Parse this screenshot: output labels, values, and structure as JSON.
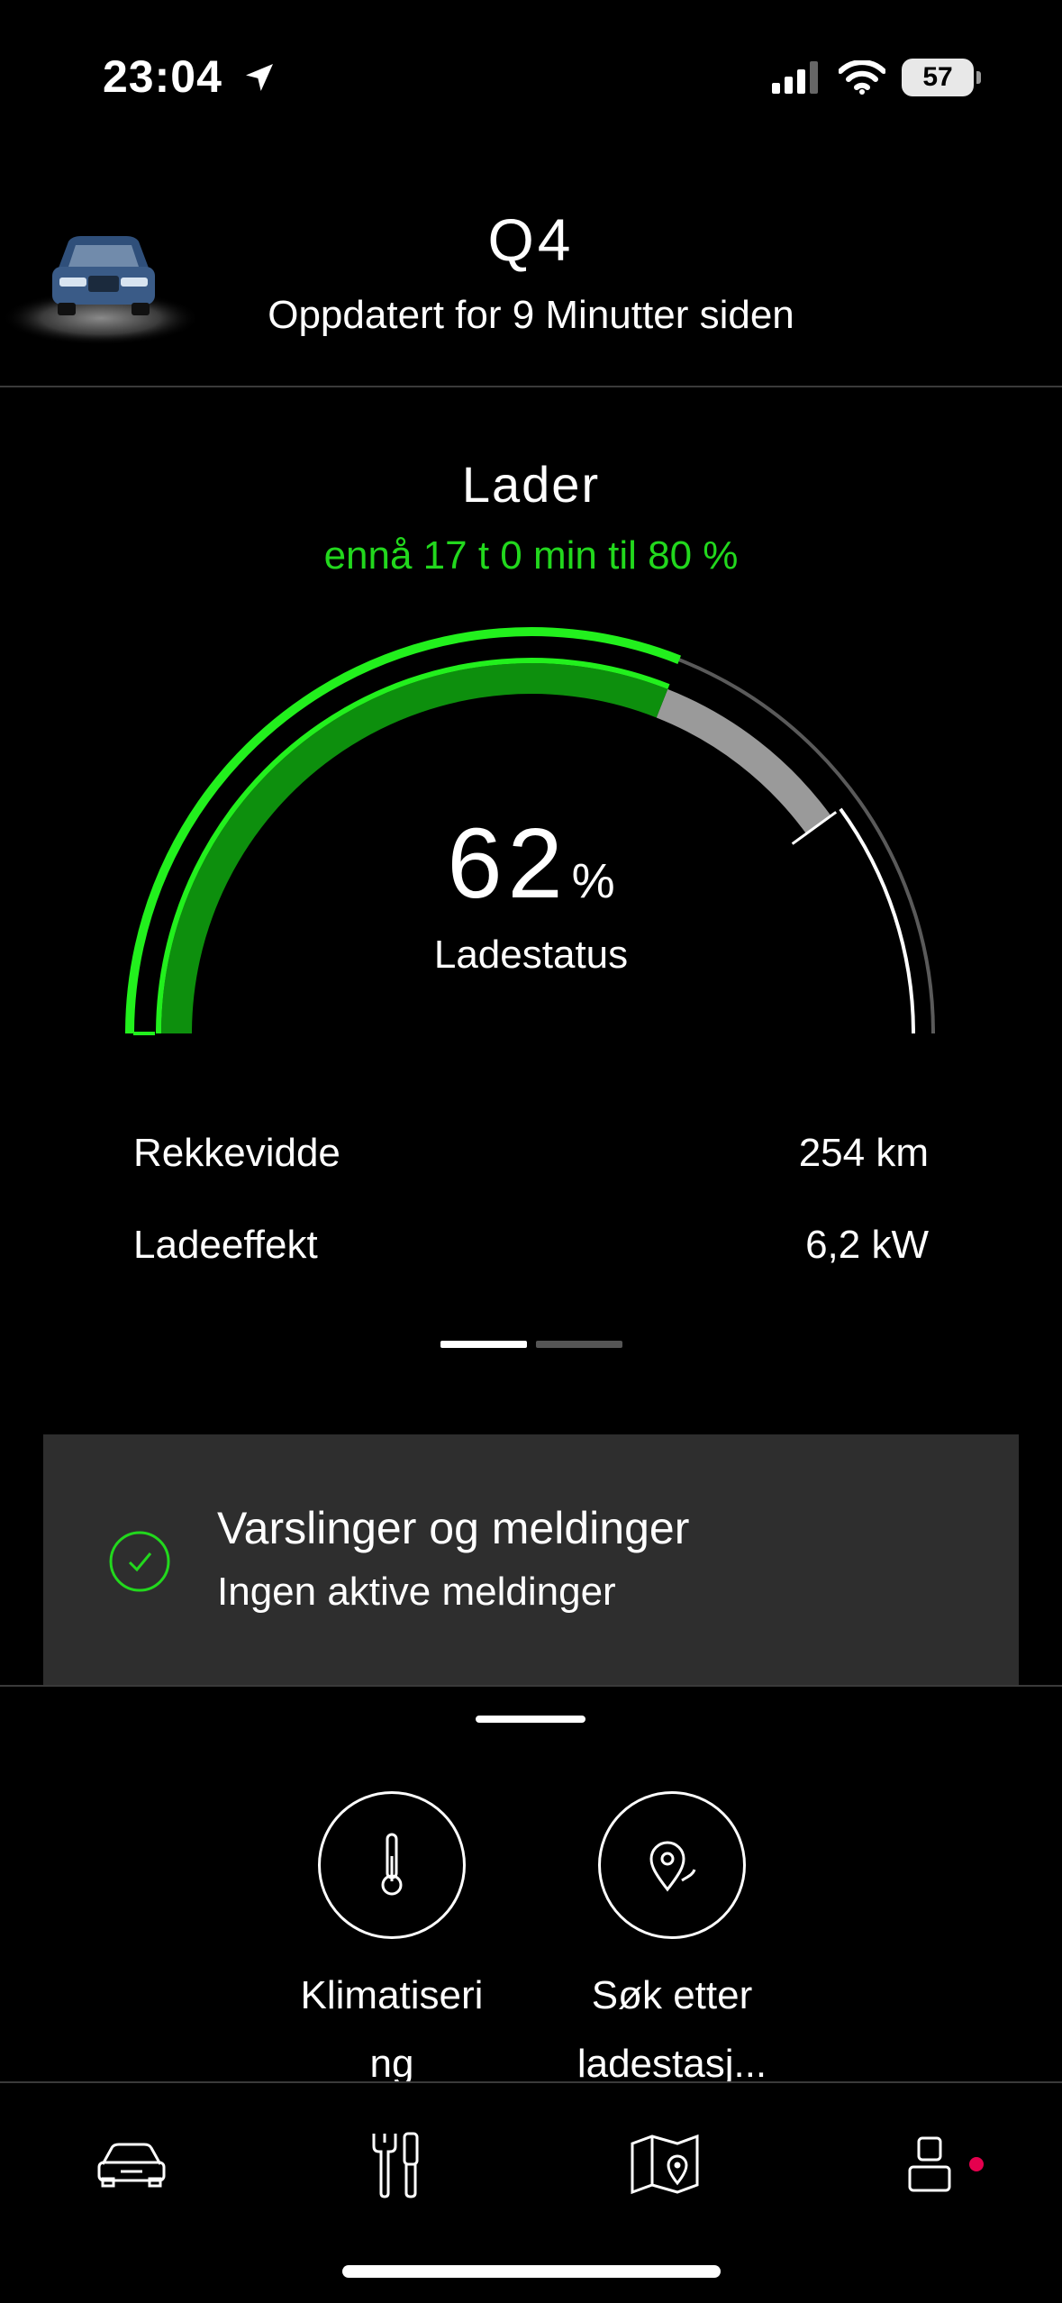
{
  "status_bar": {
    "time": "23:04",
    "battery_level": "57",
    "icons": [
      "location-arrow-icon",
      "cellular-signal-icon",
      "wifi-icon",
      "battery-icon"
    ]
  },
  "header": {
    "vehicle_name": "Q4",
    "updated": "Oppdatert for 9 Minutter siden"
  },
  "charging": {
    "title": "Lader",
    "remaining": "ennå 17 t 0 min til 80 %",
    "percent_value": "62",
    "percent_unit": "%",
    "percent_label": "Ladestatus",
    "level_fraction": 0.62,
    "target_fraction": 0.8,
    "stats": [
      {
        "label": "Rekkevidde",
        "value": "254 km"
      },
      {
        "label": "Ladeeffekt",
        "value": "6,2 kW"
      }
    ]
  },
  "pager": {
    "pages": 2,
    "active_index": 0
  },
  "notifications": {
    "title": "Varslinger og meldinger",
    "subtitle": "Ingen aktive meldinger"
  },
  "actions": [
    {
      "line1": "Klimatiseri",
      "line2": "ng",
      "icon": "thermometer-icon"
    },
    {
      "line1": "Søk etter",
      "line2": "ladestasj...",
      "icon": "charging-station-search-icon"
    }
  ],
  "tabs": [
    {
      "name": "car",
      "icon": "car-icon"
    },
    {
      "name": "service",
      "icon": "tools-icon"
    },
    {
      "name": "map",
      "icon": "map-icon"
    },
    {
      "name": "profile",
      "icon": "profile-icon",
      "badge": true
    }
  ],
  "colors": {
    "accent_green": "#22d81d",
    "dark_green": "#0d8f0d",
    "notification_badge": "#e5004e",
    "card_bg": "#2e2e2e"
  }
}
